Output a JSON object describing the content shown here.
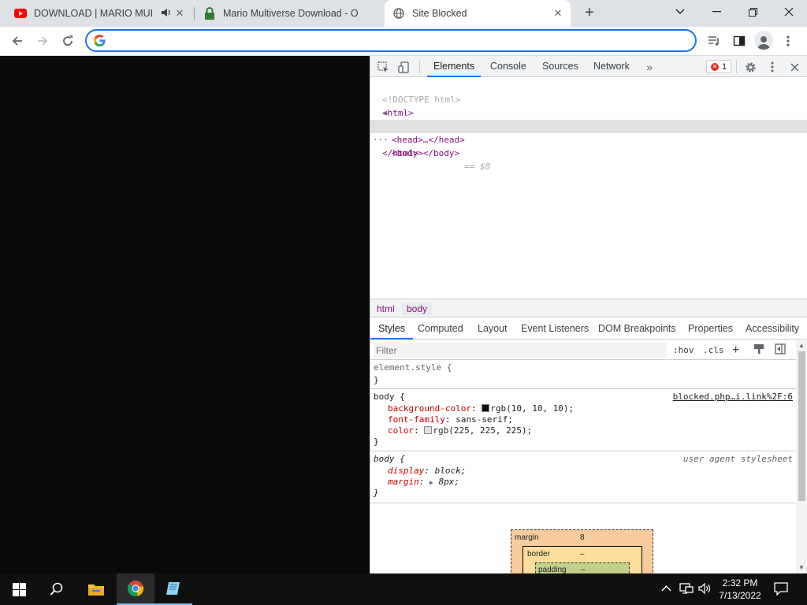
{
  "browser": {
    "tabs": [
      {
        "title": "DOWNLOAD | MARIO MULTI",
        "favicon": "youtube-icon",
        "audio": true
      },
      {
        "title": "Mario Multiverse Download - Offi",
        "favicon": "lock-icon"
      },
      {
        "title": "Site Blocked",
        "favicon": "globe-icon",
        "active": true
      }
    ],
    "omnibox": {
      "value": "",
      "placeholder": ""
    },
    "accent": "#1a73e8"
  },
  "page": {
    "background": "#0a0a0a"
  },
  "devtools": {
    "tabs": [
      "Elements",
      "Console",
      "Sources",
      "Network"
    ],
    "active_tab": "Elements",
    "error_count": "1",
    "dom": {
      "doctype": "<!DOCTYPE html>",
      "html_open": "<html>",
      "head": "<head>…</head>",
      "body": "<body></body>",
      "body_suffix": "== $0",
      "html_close": "</html>",
      "ellipsis": "···"
    },
    "breadcrumbs": [
      "html",
      "body"
    ],
    "subtabs": [
      "Styles",
      "Computed",
      "Layout",
      "Event Listeners",
      "DOM Breakpoints",
      "Properties",
      "Accessibility"
    ],
    "filter": {
      "placeholder": "Filter",
      "hov": ":hov",
      "cls": ".cls"
    },
    "rules": {
      "element_style": {
        "selector": "element.style {",
        "close": "}"
      },
      "body_author": {
        "selector": "body {",
        "source": "blocked.php…i.link%2F:6",
        "props": [
          {
            "name": "background-color",
            "value": "rgb(10, 10, 10);",
            "swatch": "#0a0a0a"
          },
          {
            "name": "font-family",
            "value": "sans-serif;"
          },
          {
            "name": "color",
            "value": "rgb(225, 225, 225);",
            "swatch": "#e1e1e1"
          }
        ],
        "close": "}"
      },
      "body_ua": {
        "selector": "body {",
        "source": "user agent stylesheet",
        "props": [
          {
            "name": "display",
            "value": "block;"
          },
          {
            "name": "margin",
            "value": "8px;"
          }
        ],
        "close": "}"
      }
    },
    "box_model": {
      "margin_label": "margin",
      "margin_value": "8",
      "border_label": "border",
      "border_value": "–",
      "padding_label": "padding",
      "padding_value": "–"
    }
  },
  "taskbar": {
    "time": "2:32 PM",
    "date": "7/13/2022"
  }
}
